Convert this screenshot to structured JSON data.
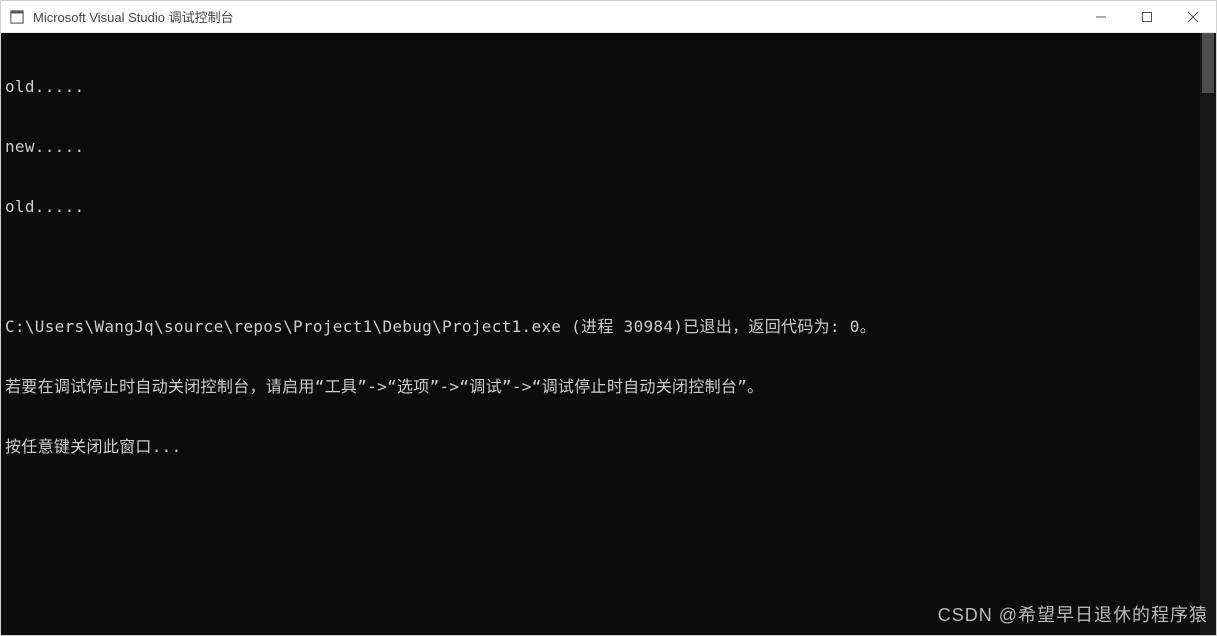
{
  "window": {
    "title": "Microsoft Visual Studio 调试控制台"
  },
  "console": {
    "lines": [
      "old.....",
      "new.....",
      "old.....",
      "",
      "C:\\Users\\WangJq\\source\\repos\\Project1\\Debug\\Project1.exe (进程 30984)已退出，返回代码为: 0。",
      "若要在调试停止时自动关闭控制台，请启用“工具”->“选项”->“调试”->“调试停止时自动关闭控制台”。",
      "按任意键关闭此窗口..."
    ]
  },
  "watermark": {
    "text": "CSDN @希望早日退休的程序猿"
  }
}
